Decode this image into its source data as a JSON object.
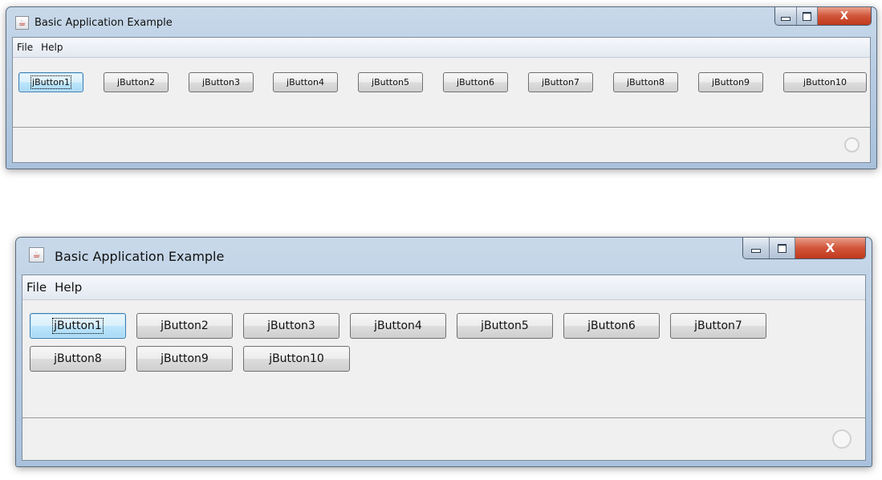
{
  "windows": [
    {
      "title": "Basic Application Example",
      "menu": [
        "File",
        "Help"
      ],
      "buttons": [
        "jButton1",
        "jButton2",
        "jButton3",
        "jButton4",
        "jButton5",
        "jButton6",
        "jButton7",
        "jButton8",
        "jButton9",
        "jButton10"
      ],
      "focused_button": "jButton1",
      "controls": {
        "minimize": "minimize-icon",
        "maximize": "maximize-icon",
        "close_label": "X"
      },
      "status_icon": "busy-indicator-icon"
    },
    {
      "title": "Basic Application Example",
      "menu": [
        "File",
        "Help"
      ],
      "buttons": [
        "jButton1",
        "jButton2",
        "jButton3",
        "jButton4",
        "jButton5",
        "jButton6",
        "jButton7",
        "jButton8",
        "jButton9",
        "jButton10"
      ],
      "focused_button": "jButton1",
      "controls": {
        "minimize": "minimize-icon",
        "maximize": "maximize-icon",
        "close_label": "X"
      },
      "status_icon": "busy-indicator-icon"
    }
  ],
  "colors": {
    "close_button": "#c0391c",
    "focused_button": "#a7d9f5",
    "frame": "#b8cde3"
  }
}
